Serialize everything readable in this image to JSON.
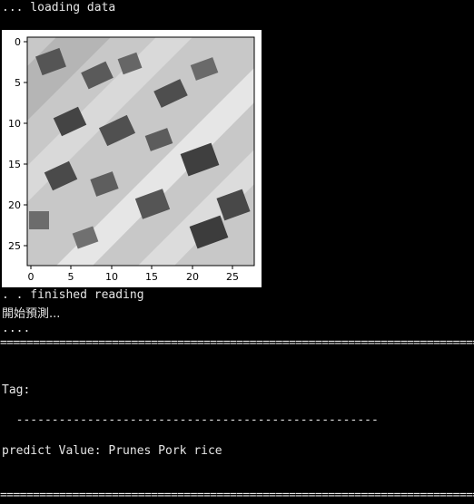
{
  "console": {
    "loading_line": "... loading data",
    "finished_line": ". . finished reading",
    "start_predict_line": "開始預測...",
    "dots_line": "....",
    "separator": "==========================================================================================",
    "tag_label": "Tag:",
    "dash_rule": "  ---------------------------------------------------",
    "predict_line": "predict Value: Prunes Pork rice",
    "separator_bottom": "=========================================================================================="
  },
  "figure": {
    "x_ticks": [
      "0",
      "5",
      "10",
      "15",
      "20",
      "25"
    ],
    "y_ticks": [
      "0",
      "5",
      "10",
      "15",
      "20",
      "25"
    ]
  }
}
